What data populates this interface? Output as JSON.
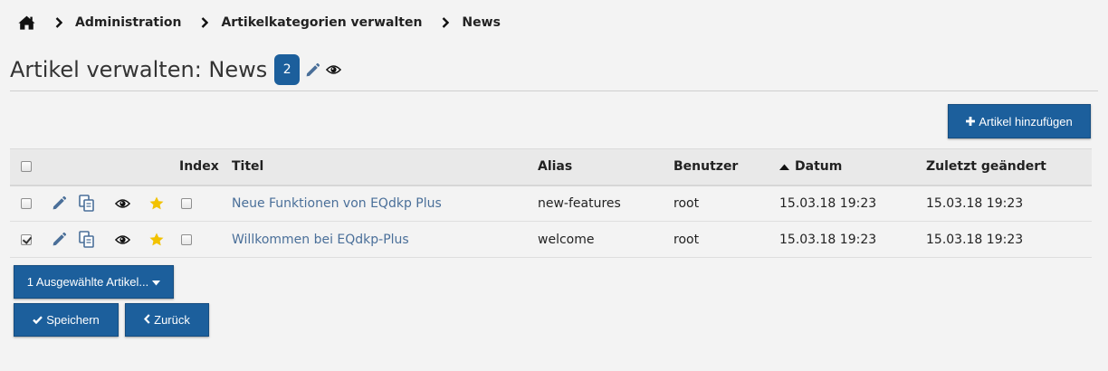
{
  "breadcrumb": {
    "items": [
      "Administration",
      "Artikelkategorien verwalten",
      "News"
    ]
  },
  "page": {
    "title": "Artikel verwalten: News",
    "count": "2"
  },
  "toolbar": {
    "add_label": "Artikel hinzufügen"
  },
  "table": {
    "headers": {
      "index": "Index",
      "title": "Titel",
      "alias": "Alias",
      "user": "Benutzer",
      "date": "Datum",
      "modified": "Zuletzt geändert"
    },
    "sort": {
      "column": "date",
      "direction": "ascending"
    },
    "rows": [
      {
        "checked": false,
        "title": "Neue Funktionen von EQdkp Plus",
        "alias": "new-features",
        "user": "root",
        "date": "15.03.18 19:23",
        "modified": "15.03.18 19:23"
      },
      {
        "checked": true,
        "title": "Willkommen bei EQdkp-Plus",
        "alias": "welcome",
        "user": "root",
        "date": "15.03.18 19:23",
        "modified": "15.03.18 19:23"
      }
    ]
  },
  "actions": {
    "selected_label": "1 Ausgewählte Artikel...",
    "save_label": "Speichern",
    "back_label": "Zurück"
  },
  "colors": {
    "primary": "#1c5f9c",
    "link": "#4a6f99",
    "star": "#f2c200",
    "background": "#f3f3f3"
  },
  "icons": [
    "home-icon",
    "chevron-right-icon",
    "pencil-icon",
    "eye-icon",
    "copy-icon",
    "star-icon",
    "plus-icon",
    "check-icon",
    "chevron-left-icon",
    "caret-down-icon",
    "sort-up-icon"
  ]
}
